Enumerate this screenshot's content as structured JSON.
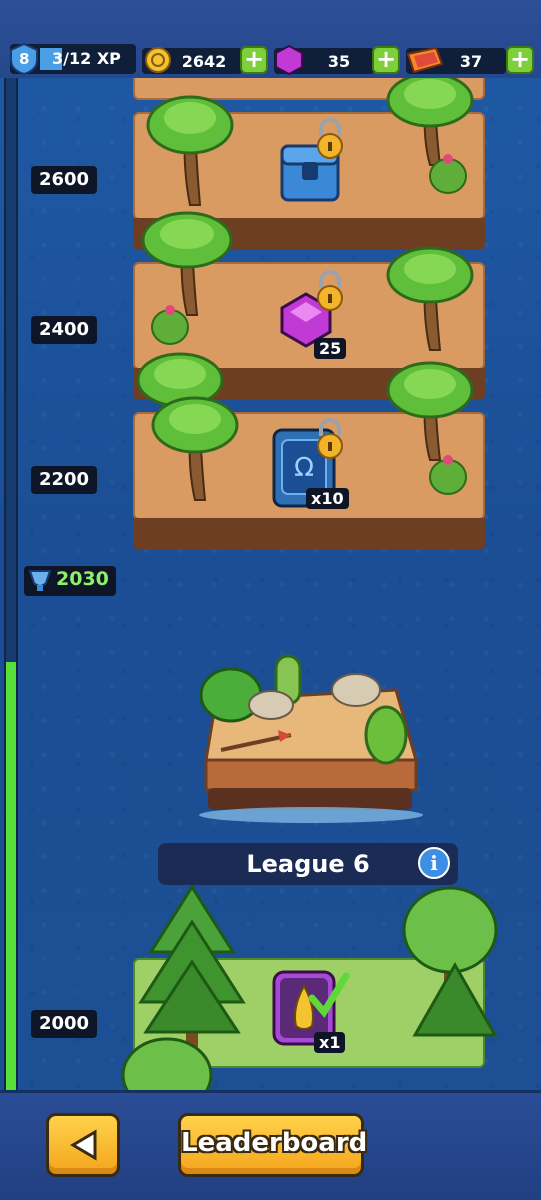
{
  "hud": {
    "level": "8",
    "xp_text": "3/12 XP",
    "coins": "2642",
    "gems": "35",
    "tickets": "37"
  },
  "milestones": [
    {
      "score": "2600",
      "reward": "chest",
      "badge": ""
    },
    {
      "score": "2400",
      "reward": "gem",
      "badge": "25"
    },
    {
      "score": "2200",
      "reward": "card",
      "badge": "x10"
    }
  ],
  "current_trophies": "2030",
  "league": {
    "title": "League 6"
  },
  "base_milestone": {
    "score": "2000",
    "reward": "hero",
    "badge": "x1"
  },
  "progress_fraction": 0.47,
  "bottom": {
    "leaderboard_label": "Leaderboard"
  },
  "icons": {
    "level": "level-shield-icon",
    "coin": "coin-icon",
    "gem": "gem-icon",
    "ticket": "ticket-icon",
    "trophy": "trophy-icon",
    "lock": "lock-icon",
    "info": "info-icon",
    "back": "back-arrow-icon",
    "check": "checkmark-icon"
  },
  "colors": {
    "accent_green": "#7ed03a",
    "button_yellow": "#f3a51c",
    "progress": "#58e03a"
  }
}
